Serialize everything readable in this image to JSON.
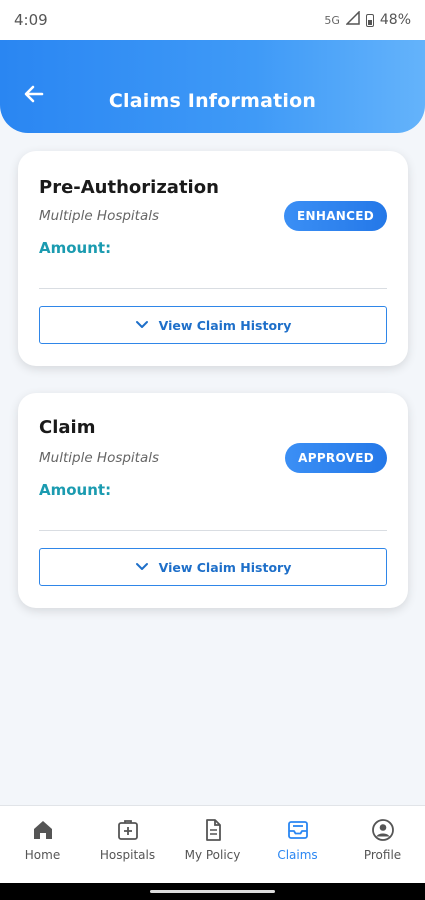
{
  "status_bar": {
    "time": "4:09",
    "network": "5G",
    "battery": "48%"
  },
  "header": {
    "title": "Claims Information"
  },
  "cards": [
    {
      "title": "Pre-Authorization",
      "subtitle": "Multiple Hospitals",
      "amount_label": "Amount:",
      "badge": "ENHANCED",
      "history_button": "View Claim History"
    },
    {
      "title": "Claim",
      "subtitle": "Multiple Hospitals",
      "amount_label": "Amount:",
      "badge": "APPROVED",
      "history_button": "View Claim History"
    }
  ],
  "bottom_nav": {
    "items": [
      {
        "label": "Home",
        "icon": "home-icon"
      },
      {
        "label": "Hospitals",
        "icon": "hospital-icon"
      },
      {
        "label": "My Policy",
        "icon": "document-icon"
      },
      {
        "label": "Claims",
        "icon": "claims-tray-icon",
        "active": true
      },
      {
        "label": "Profile",
        "icon": "profile-icon"
      }
    ]
  },
  "colors": {
    "accent": "#2a86f2",
    "amount": "#1b9bb0",
    "background": "#f3f6fa"
  }
}
